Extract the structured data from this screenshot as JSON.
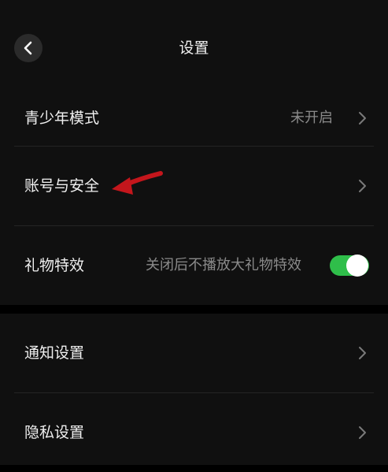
{
  "header": {
    "title": "设置",
    "back_icon": "chevron-left-icon"
  },
  "settings": {
    "teen_mode": {
      "label": "青少年模式",
      "value": "未开启"
    },
    "account_security": {
      "label": "账号与安全"
    },
    "gift_effects": {
      "label": "礼物特效",
      "description": "关闭后不播放大礼物特效",
      "enabled": true
    },
    "notifications": {
      "label": "通知设置"
    },
    "privacy": {
      "label": "隐私设置"
    }
  },
  "colors": {
    "background": "#000000",
    "card": "#101010",
    "toggle_on": "#2fbe4a",
    "arrow": "#c4161c"
  }
}
